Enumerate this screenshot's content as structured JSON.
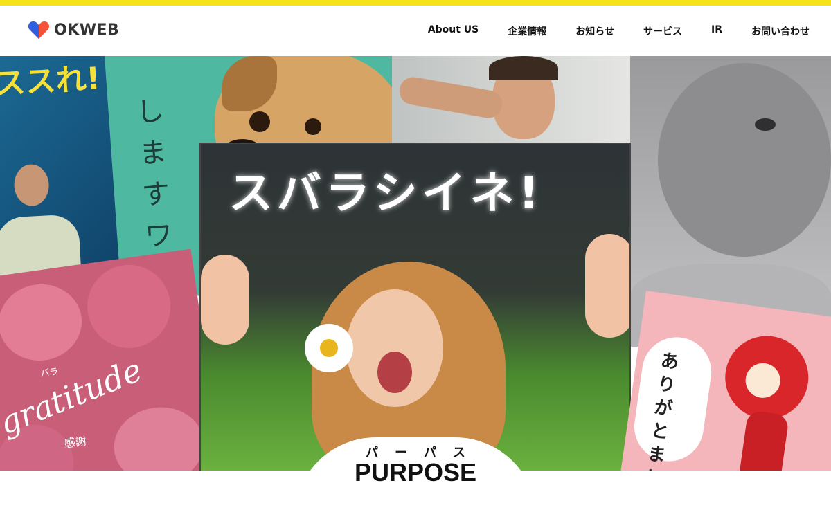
{
  "brand": {
    "name": "OKWEB",
    "heart_colors": [
      "#f4533a",
      "#2f5fe0"
    ]
  },
  "nav": [
    {
      "label": "About US"
    },
    {
      "label": "企業情報"
    },
    {
      "label": "お知らせ"
    },
    {
      "label": "サービス"
    },
    {
      "label": "IR"
    },
    {
      "label": "お問い合わせ"
    }
  ],
  "hero": {
    "cards": {
      "top_left_text": "ススれ!",
      "green_card_text": "します ワン",
      "main_card_text": "スバラシイネ!",
      "roses_small": "バラ",
      "roses_word": "gratitude",
      "roses_jp": "感謝",
      "tomato_text": "ありが とまと"
    }
  },
  "section": {
    "ruby": "パーパス",
    "title": "PURPOSE"
  },
  "colors": {
    "topbar": "#f7e11b",
    "accent_yellow": "#f5d92a"
  }
}
